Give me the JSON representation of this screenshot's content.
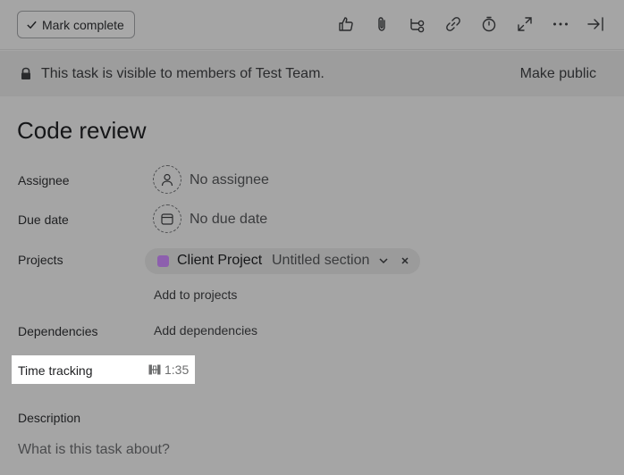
{
  "toolbar": {
    "mark_complete_label": "Mark complete",
    "icons": [
      "thumbs-up-icon",
      "paperclip-icon",
      "subtask-icon",
      "link-icon",
      "timer-icon",
      "expand-icon",
      "more-icon",
      "close-panel-icon"
    ]
  },
  "banner": {
    "text": "This task is visible to members of Test Team.",
    "action": "Make public"
  },
  "task": {
    "title": "Code review",
    "fields": {
      "assignee_label": "Assignee",
      "assignee_value": "No assignee",
      "due_date_label": "Due date",
      "due_date_value": "No due date",
      "projects_label": "Projects",
      "project_name": "Client Project",
      "project_section": "Untitled section",
      "project_color": "#8d5fae",
      "add_to_projects": "Add to projects",
      "dependencies_label": "Dependencies",
      "add_dependencies": "Add dependencies",
      "time_tracking_label": "Time tracking",
      "time_tracking_value": "1:35",
      "description_label": "Description",
      "description_placeholder": "What is this task about?"
    }
  }
}
